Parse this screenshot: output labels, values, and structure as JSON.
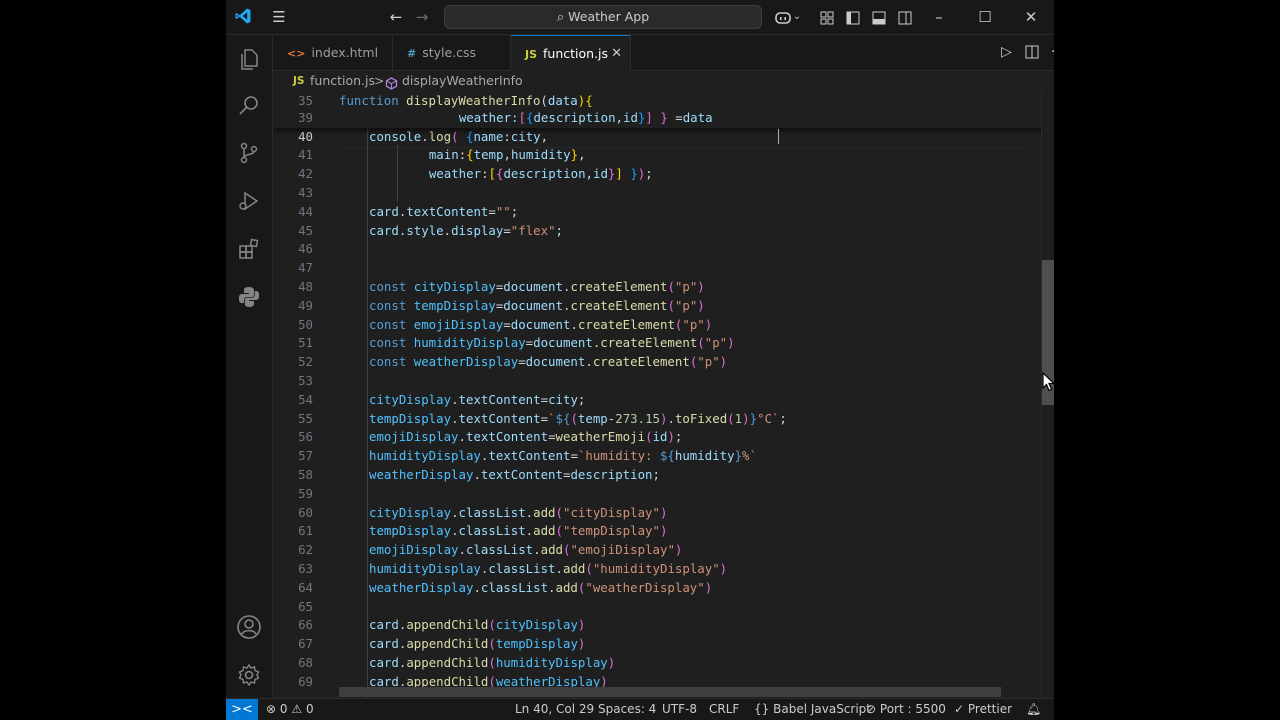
{
  "titlebar": {
    "search_label": "Weather App"
  },
  "tabs": [
    {
      "icon": "<>",
      "label": "index.html"
    },
    {
      "icon": "#",
      "label": "style.css"
    },
    {
      "icon": "JS",
      "label": "function.js"
    }
  ],
  "breadcrumb": {
    "file_icon": "JS",
    "file": "function.js",
    "separator": ">",
    "symbol": "displayWeatherInfo"
  },
  "editor": {
    "current_line": 40,
    "sticky_lines": [
      {
        "num": 35,
        "tokens": [
          [
            "function ",
            "#569cd6"
          ],
          [
            "displayWeatherInfo",
            "#dcdcaa"
          ],
          [
            "(",
            "#d4d4d4"
          ],
          [
            "data",
            "#9cdcfe"
          ],
          [
            "){",
            "#ffd700"
          ]
        ]
      },
      {
        "num": 39,
        "tokens": [
          [
            "    weather:",
            "#9cdcfe"
          ],
          [
            "[",
            "#da70d6"
          ],
          [
            "{",
            "#179fff"
          ],
          [
            "description",
            "#9cdcfe"
          ],
          [
            ",",
            "#d4d4d4"
          ],
          [
            "id",
            "#9cdcfe"
          ],
          [
            "}",
            "#179fff"
          ],
          [
            "]",
            "#da70d6"
          ],
          [
            " } ",
            "#da70d6"
          ],
          [
            "=",
            "#d4d4d4"
          ],
          [
            "data",
            "#9cdcfe"
          ]
        ]
      }
    ],
    "lines": [
      {
        "num": 40,
        "tokens": [
          [
            "console",
            "#9cdcfe"
          ],
          [
            ".",
            "#d4d4d4"
          ],
          [
            "log",
            "#dcdcaa"
          ],
          [
            "( ",
            "#da70d6"
          ],
          [
            "{",
            "#179fff"
          ],
          [
            "name",
            "#9cdcfe"
          ],
          [
            ":",
            "#d4d4d4"
          ],
          [
            "city",
            "#9cdcfe"
          ],
          [
            ",",
            "#d4d4d4"
          ]
        ]
      },
      {
        "num": 41,
        "tokens": [
          [
            "    main",
            "#9cdcfe"
          ],
          [
            ":",
            "#d4d4d4"
          ],
          [
            "{",
            "#ffd700"
          ],
          [
            "temp",
            "#9cdcfe"
          ],
          [
            ",",
            "#d4d4d4"
          ],
          [
            "humidity",
            "#9cdcfe"
          ],
          [
            "}",
            "#ffd700"
          ],
          [
            ",",
            "#d4d4d4"
          ]
        ]
      },
      {
        "num": 42,
        "tokens": [
          [
            "    weather",
            "#9cdcfe"
          ],
          [
            ":",
            "#d4d4d4"
          ],
          [
            "[",
            "#ffd700"
          ],
          [
            "{",
            "#da70d6"
          ],
          [
            "description",
            "#9cdcfe"
          ],
          [
            ",",
            "#d4d4d4"
          ],
          [
            "id",
            "#9cdcfe"
          ],
          [
            "}",
            "#da70d6"
          ],
          [
            "] ",
            "#ffd700"
          ],
          [
            "}",
            "#179fff"
          ],
          [
            ")",
            "#da70d6"
          ],
          [
            ";",
            "#d4d4d4"
          ]
        ]
      },
      {
        "num": 43,
        "tokens": []
      },
      {
        "num": 44,
        "tokens": [
          [
            "card",
            "#9cdcfe"
          ],
          [
            ".",
            "#d4d4d4"
          ],
          [
            "textContent",
            "#9cdcfe"
          ],
          [
            "=",
            "#d4d4d4"
          ],
          [
            "\"\"",
            "#ce9178"
          ],
          [
            ";",
            "#d4d4d4"
          ]
        ]
      },
      {
        "num": 45,
        "tokens": [
          [
            "card",
            "#9cdcfe"
          ],
          [
            ".",
            "#d4d4d4"
          ],
          [
            "style",
            "#9cdcfe"
          ],
          [
            ".",
            "#d4d4d4"
          ],
          [
            "display",
            "#9cdcfe"
          ],
          [
            "=",
            "#d4d4d4"
          ],
          [
            "\"flex\"",
            "#ce9178"
          ],
          [
            ";",
            "#d4d4d4"
          ]
        ]
      },
      {
        "num": 46,
        "tokens": []
      },
      {
        "num": 47,
        "tokens": []
      },
      {
        "num": 48,
        "tokens": [
          [
            "const ",
            "#569cd6"
          ],
          [
            "cityDisplay",
            "#4fc1ff"
          ],
          [
            "=",
            "#d4d4d4"
          ],
          [
            "document",
            "#9cdcfe"
          ],
          [
            ".",
            "#d4d4d4"
          ],
          [
            "createElement",
            "#dcdcaa"
          ],
          [
            "(",
            "#da70d6"
          ],
          [
            "\"p\"",
            "#ce9178"
          ],
          [
            ")",
            "#da70d6"
          ]
        ]
      },
      {
        "num": 49,
        "tokens": [
          [
            "const ",
            "#569cd6"
          ],
          [
            "tempDisplay",
            "#4fc1ff"
          ],
          [
            "=",
            "#d4d4d4"
          ],
          [
            "document",
            "#9cdcfe"
          ],
          [
            ".",
            "#d4d4d4"
          ],
          [
            "createElement",
            "#dcdcaa"
          ],
          [
            "(",
            "#da70d6"
          ],
          [
            "\"p\"",
            "#ce9178"
          ],
          [
            ")",
            "#da70d6"
          ]
        ]
      },
      {
        "num": 50,
        "tokens": [
          [
            "const ",
            "#569cd6"
          ],
          [
            "emojiDisplay",
            "#4fc1ff"
          ],
          [
            "=",
            "#d4d4d4"
          ],
          [
            "document",
            "#9cdcfe"
          ],
          [
            ".",
            "#d4d4d4"
          ],
          [
            "createElement",
            "#dcdcaa"
          ],
          [
            "(",
            "#da70d6"
          ],
          [
            "\"p\"",
            "#ce9178"
          ],
          [
            ")",
            "#da70d6"
          ]
        ]
      },
      {
        "num": 51,
        "tokens": [
          [
            "const ",
            "#569cd6"
          ],
          [
            "humidityDisplay",
            "#4fc1ff"
          ],
          [
            "=",
            "#d4d4d4"
          ],
          [
            "document",
            "#9cdcfe"
          ],
          [
            ".",
            "#d4d4d4"
          ],
          [
            "createElement",
            "#dcdcaa"
          ],
          [
            "(",
            "#da70d6"
          ],
          [
            "\"p\"",
            "#ce9178"
          ],
          [
            ")",
            "#da70d6"
          ]
        ]
      },
      {
        "num": 52,
        "tokens": [
          [
            "const ",
            "#569cd6"
          ],
          [
            "weatherDisplay",
            "#4fc1ff"
          ],
          [
            "=",
            "#d4d4d4"
          ],
          [
            "document",
            "#9cdcfe"
          ],
          [
            ".",
            "#d4d4d4"
          ],
          [
            "createElement",
            "#dcdcaa"
          ],
          [
            "(",
            "#da70d6"
          ],
          [
            "\"p\"",
            "#ce9178"
          ],
          [
            ")",
            "#da70d6"
          ]
        ]
      },
      {
        "num": 53,
        "tokens": []
      },
      {
        "num": 54,
        "tokens": [
          [
            "cityDisplay",
            "#4fc1ff"
          ],
          [
            ".",
            "#d4d4d4"
          ],
          [
            "textContent",
            "#9cdcfe"
          ],
          [
            "=",
            "#d4d4d4"
          ],
          [
            "city",
            "#9cdcfe"
          ],
          [
            ";",
            "#d4d4d4"
          ]
        ]
      },
      {
        "num": 55,
        "tokens": [
          [
            "tempDisplay",
            "#4fc1ff"
          ],
          [
            ".",
            "#d4d4d4"
          ],
          [
            "textContent",
            "#9cdcfe"
          ],
          [
            "=",
            "#d4d4d4"
          ],
          [
            "`",
            "#ce9178"
          ],
          [
            "${",
            "#569cd6"
          ],
          [
            "(",
            "#da70d6"
          ],
          [
            "temp",
            "#9cdcfe"
          ],
          [
            "-",
            "#d4d4d4"
          ],
          [
            "273.15",
            "#b5cea8"
          ],
          [
            ")",
            "#da70d6"
          ],
          [
            ".",
            "#d4d4d4"
          ],
          [
            "toFixed",
            "#dcdcaa"
          ],
          [
            "(",
            "#da70d6"
          ],
          [
            "1",
            "#b5cea8"
          ],
          [
            ")",
            "#da70d6"
          ],
          [
            "}",
            "#569cd6"
          ],
          [
            "°C`",
            "#ce9178"
          ],
          [
            ";",
            "#d4d4d4"
          ]
        ]
      },
      {
        "num": 56,
        "tokens": [
          [
            "emojiDisplay",
            "#4fc1ff"
          ],
          [
            ".",
            "#d4d4d4"
          ],
          [
            "textContent",
            "#9cdcfe"
          ],
          [
            "=",
            "#d4d4d4"
          ],
          [
            "weatherEmoji",
            "#dcdcaa"
          ],
          [
            "(",
            "#da70d6"
          ],
          [
            "id",
            "#9cdcfe"
          ],
          [
            ")",
            "#da70d6"
          ],
          [
            ";",
            "#d4d4d4"
          ]
        ]
      },
      {
        "num": 57,
        "tokens": [
          [
            "humidityDisplay",
            "#4fc1ff"
          ],
          [
            ".",
            "#d4d4d4"
          ],
          [
            "textContent",
            "#9cdcfe"
          ],
          [
            "=",
            "#d4d4d4"
          ],
          [
            "`humidity: ",
            "#ce9178"
          ],
          [
            "${",
            "#569cd6"
          ],
          [
            "humidity",
            "#9cdcfe"
          ],
          [
            "}",
            "#569cd6"
          ],
          [
            "%`",
            "#ce9178"
          ]
        ]
      },
      {
        "num": 58,
        "tokens": [
          [
            "weatherDisplay",
            "#4fc1ff"
          ],
          [
            ".",
            "#d4d4d4"
          ],
          [
            "textContent",
            "#9cdcfe"
          ],
          [
            "=",
            "#d4d4d4"
          ],
          [
            "description",
            "#9cdcfe"
          ],
          [
            ";",
            "#d4d4d4"
          ]
        ]
      },
      {
        "num": 59,
        "tokens": []
      },
      {
        "num": 60,
        "tokens": [
          [
            "cityDisplay",
            "#4fc1ff"
          ],
          [
            ".",
            "#d4d4d4"
          ],
          [
            "classList",
            "#9cdcfe"
          ],
          [
            ".",
            "#d4d4d4"
          ],
          [
            "add",
            "#dcdcaa"
          ],
          [
            "(",
            "#da70d6"
          ],
          [
            "\"cityDisplay\"",
            "#ce9178"
          ],
          [
            ")",
            "#da70d6"
          ]
        ]
      },
      {
        "num": 61,
        "tokens": [
          [
            "tempDisplay",
            "#4fc1ff"
          ],
          [
            ".",
            "#d4d4d4"
          ],
          [
            "classList",
            "#9cdcfe"
          ],
          [
            ".",
            "#d4d4d4"
          ],
          [
            "add",
            "#dcdcaa"
          ],
          [
            "(",
            "#da70d6"
          ],
          [
            "\"tempDisplay\"",
            "#ce9178"
          ],
          [
            ")",
            "#da70d6"
          ]
        ]
      },
      {
        "num": 62,
        "tokens": [
          [
            "emojiDisplay",
            "#4fc1ff"
          ],
          [
            ".",
            "#d4d4d4"
          ],
          [
            "classList",
            "#9cdcfe"
          ],
          [
            ".",
            "#d4d4d4"
          ],
          [
            "add",
            "#dcdcaa"
          ],
          [
            "(",
            "#da70d6"
          ],
          [
            "\"emojiDisplay\"",
            "#ce9178"
          ],
          [
            ")",
            "#da70d6"
          ]
        ]
      },
      {
        "num": 63,
        "tokens": [
          [
            "humidityDisplay",
            "#4fc1ff"
          ],
          [
            ".",
            "#d4d4d4"
          ],
          [
            "classList",
            "#9cdcfe"
          ],
          [
            ".",
            "#d4d4d4"
          ],
          [
            "add",
            "#dcdcaa"
          ],
          [
            "(",
            "#da70d6"
          ],
          [
            "\"humidityDisplay\"",
            "#ce9178"
          ],
          [
            ")",
            "#da70d6"
          ]
        ]
      },
      {
        "num": 64,
        "tokens": [
          [
            "weatherDisplay",
            "#4fc1ff"
          ],
          [
            ".",
            "#d4d4d4"
          ],
          [
            "classList",
            "#9cdcfe"
          ],
          [
            ".",
            "#d4d4d4"
          ],
          [
            "add",
            "#dcdcaa"
          ],
          [
            "(",
            "#da70d6"
          ],
          [
            "\"weatherDisplay\"",
            "#ce9178"
          ],
          [
            ")",
            "#da70d6"
          ]
        ]
      },
      {
        "num": 65,
        "tokens": []
      },
      {
        "num": 66,
        "tokens": [
          [
            "card",
            "#9cdcfe"
          ],
          [
            ".",
            "#d4d4d4"
          ],
          [
            "appendChild",
            "#dcdcaa"
          ],
          [
            "(",
            "#da70d6"
          ],
          [
            "cityDisplay",
            "#4fc1ff"
          ],
          [
            ")",
            "#da70d6"
          ]
        ]
      },
      {
        "num": 67,
        "tokens": [
          [
            "card",
            "#9cdcfe"
          ],
          [
            ".",
            "#d4d4d4"
          ],
          [
            "appendChild",
            "#dcdcaa"
          ],
          [
            "(",
            "#da70d6"
          ],
          [
            "tempDisplay",
            "#4fc1ff"
          ],
          [
            ")",
            "#da70d6"
          ]
        ]
      },
      {
        "num": 68,
        "tokens": [
          [
            "card",
            "#9cdcfe"
          ],
          [
            ".",
            "#d4d4d4"
          ],
          [
            "appendChild",
            "#dcdcaa"
          ],
          [
            "(",
            "#da70d6"
          ],
          [
            "humidityDisplay",
            "#4fc1ff"
          ],
          [
            ")",
            "#da70d6"
          ]
        ]
      },
      {
        "num": 69,
        "tokens": [
          [
            "card",
            "#9cdcfe"
          ],
          [
            ".",
            "#d4d4d4"
          ],
          [
            "appendChild",
            "#dcdcaa"
          ],
          [
            "(",
            "#da70d6"
          ],
          [
            "weatherDisplay",
            "#4fc1ff"
          ],
          [
            ")",
            "#da70d6"
          ]
        ]
      }
    ]
  },
  "statusbar": {
    "remote_icon": "><",
    "errors": "0",
    "warnings": "0",
    "position": "Ln 40, Col 29",
    "spaces": "Spaces: 4",
    "encoding": "UTF-8",
    "eol": "CRLF",
    "language": "Babel JavaScript",
    "port": "Port : 5500",
    "formatter": "Prettier"
  },
  "colors": {
    "accent": "#0078d4",
    "editor_bg": "#1f1f1f",
    "chrome_bg": "#181818"
  }
}
